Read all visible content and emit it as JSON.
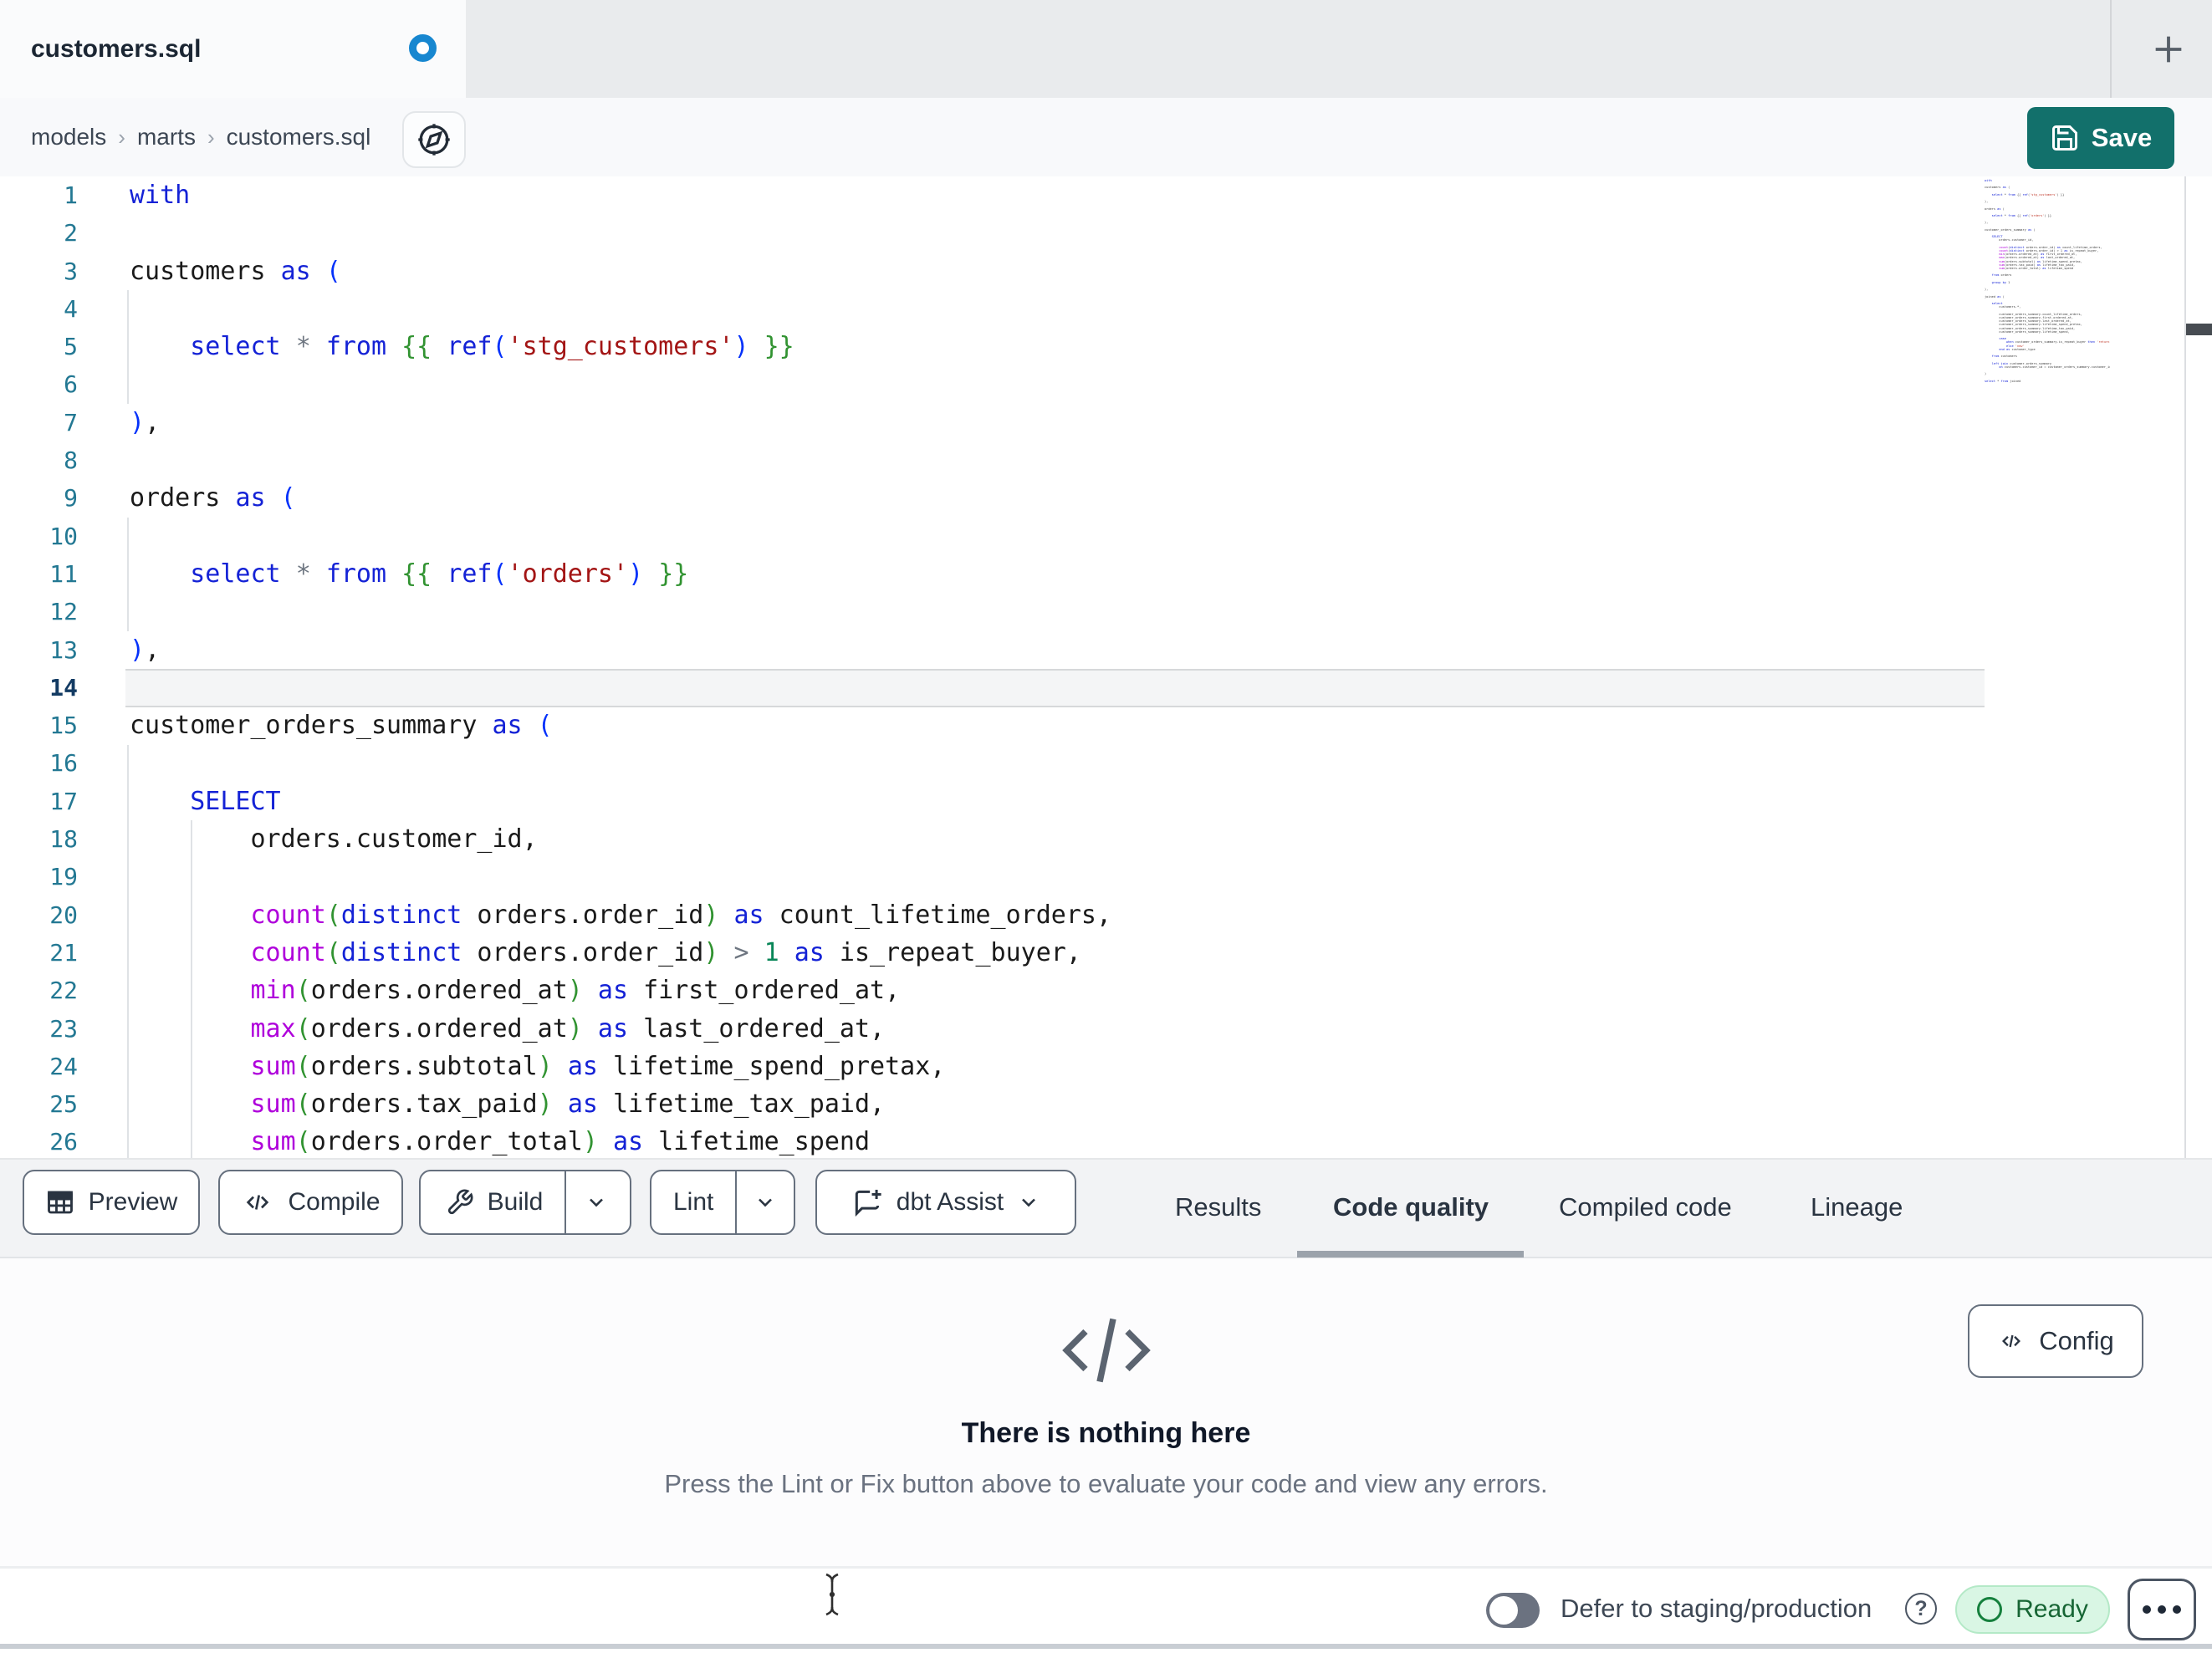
{
  "window": {
    "tab_title": "customers.sql",
    "modified": true,
    "new_tab_label": "+"
  },
  "breadcrumb": {
    "items": [
      "models",
      "marts",
      "customers.sql"
    ]
  },
  "save_label": "Save",
  "editor": {
    "active_line": 14,
    "lines": [
      {
        "n": 1,
        "tokens": [
          [
            "with",
            "k"
          ]
        ]
      },
      {
        "n": 2,
        "tokens": []
      },
      {
        "n": 3,
        "tokens": [
          [
            "customers ",
            "t"
          ],
          [
            "as",
            "k"
          ],
          [
            " ",
            "t"
          ],
          [
            "(",
            "b1"
          ]
        ]
      },
      {
        "n": 4,
        "tokens": []
      },
      {
        "n": 5,
        "tokens": [
          [
            "    ",
            "t"
          ],
          [
            "select",
            "k"
          ],
          [
            " ",
            "t"
          ],
          [
            "*",
            "o"
          ],
          [
            " ",
            "t"
          ],
          [
            "from",
            "k"
          ],
          [
            " ",
            "t"
          ],
          [
            "{{",
            "b2"
          ],
          [
            " ",
            "t"
          ],
          [
            "ref",
            "k"
          ],
          [
            "(",
            "b1"
          ],
          [
            "'stg_customers'",
            "s"
          ],
          [
            ")",
            "b1"
          ],
          [
            " ",
            "t"
          ],
          [
            "}}",
            "b2"
          ]
        ]
      },
      {
        "n": 6,
        "tokens": []
      },
      {
        "n": 7,
        "tokens": [
          [
            ")",
            "b1"
          ],
          [
            ",",
            "t"
          ]
        ]
      },
      {
        "n": 8,
        "tokens": []
      },
      {
        "n": 9,
        "tokens": [
          [
            "orders ",
            "t"
          ],
          [
            "as",
            "k"
          ],
          [
            " ",
            "t"
          ],
          [
            "(",
            "b1"
          ]
        ]
      },
      {
        "n": 10,
        "tokens": []
      },
      {
        "n": 11,
        "tokens": [
          [
            "    ",
            "t"
          ],
          [
            "select",
            "k"
          ],
          [
            " ",
            "t"
          ],
          [
            "*",
            "o"
          ],
          [
            " ",
            "t"
          ],
          [
            "from",
            "k"
          ],
          [
            " ",
            "t"
          ],
          [
            "{{",
            "b2"
          ],
          [
            " ",
            "t"
          ],
          [
            "ref",
            "k"
          ],
          [
            "(",
            "b1"
          ],
          [
            "'orders'",
            "s"
          ],
          [
            ")",
            "b1"
          ],
          [
            " ",
            "t"
          ],
          [
            "}}",
            "b2"
          ]
        ]
      },
      {
        "n": 12,
        "tokens": []
      },
      {
        "n": 13,
        "tokens": [
          [
            ")",
            "b1"
          ],
          [
            ",",
            "t"
          ]
        ]
      },
      {
        "n": 14,
        "tokens": []
      },
      {
        "n": 15,
        "tokens": [
          [
            "customer_orders_summary ",
            "t"
          ],
          [
            "as",
            "k"
          ],
          [
            " ",
            "t"
          ],
          [
            "(",
            "b1"
          ]
        ]
      },
      {
        "n": 16,
        "tokens": []
      },
      {
        "n": 17,
        "tokens": [
          [
            "    ",
            "t"
          ],
          [
            "SELECT",
            "k"
          ]
        ]
      },
      {
        "n": 18,
        "tokens": [
          [
            "        orders.customer_id,",
            "t"
          ]
        ]
      },
      {
        "n": 19,
        "tokens": []
      },
      {
        "n": 20,
        "tokens": [
          [
            "        ",
            "t"
          ],
          [
            "count",
            "f"
          ],
          [
            "(",
            "b2"
          ],
          [
            "distinct",
            "k"
          ],
          [
            " orders.order_id",
            "t"
          ],
          [
            ")",
            "b2"
          ],
          [
            " ",
            "t"
          ],
          [
            "as",
            "k"
          ],
          [
            " count_lifetime_orders,",
            "t"
          ]
        ]
      },
      {
        "n": 21,
        "tokens": [
          [
            "        ",
            "t"
          ],
          [
            "count",
            "f"
          ],
          [
            "(",
            "b2"
          ],
          [
            "distinct",
            "k"
          ],
          [
            " orders.order_id",
            "t"
          ],
          [
            ")",
            "b2"
          ],
          [
            " ",
            "t"
          ],
          [
            ">",
            "o"
          ],
          [
            " ",
            "t"
          ],
          [
            "1",
            "n"
          ],
          [
            " ",
            "t"
          ],
          [
            "as",
            "k"
          ],
          [
            " is_repeat_buyer,",
            "t"
          ]
        ]
      },
      {
        "n": 22,
        "tokens": [
          [
            "        ",
            "t"
          ],
          [
            "min",
            "f"
          ],
          [
            "(",
            "b2"
          ],
          [
            "orders.ordered_at",
            "t"
          ],
          [
            ")",
            "b2"
          ],
          [
            " ",
            "t"
          ],
          [
            "as",
            "k"
          ],
          [
            " first_ordered_at,",
            "t"
          ]
        ]
      },
      {
        "n": 23,
        "tokens": [
          [
            "        ",
            "t"
          ],
          [
            "max",
            "f"
          ],
          [
            "(",
            "b2"
          ],
          [
            "orders.ordered_at",
            "t"
          ],
          [
            ")",
            "b2"
          ],
          [
            " ",
            "t"
          ],
          [
            "as",
            "k"
          ],
          [
            " last_ordered_at,",
            "t"
          ]
        ]
      },
      {
        "n": 24,
        "tokens": [
          [
            "        ",
            "t"
          ],
          [
            "sum",
            "f"
          ],
          [
            "(",
            "b2"
          ],
          [
            "orders.subtotal",
            "t"
          ],
          [
            ")",
            "b2"
          ],
          [
            " ",
            "t"
          ],
          [
            "as",
            "k"
          ],
          [
            " lifetime_spend_pretax,",
            "t"
          ]
        ]
      },
      {
        "n": 25,
        "tokens": [
          [
            "        ",
            "t"
          ],
          [
            "sum",
            "f"
          ],
          [
            "(",
            "b2"
          ],
          [
            "orders.tax_paid",
            "t"
          ],
          [
            ")",
            "b2"
          ],
          [
            " ",
            "t"
          ],
          [
            "as",
            "k"
          ],
          [
            " lifetime_tax_paid,",
            "t"
          ]
        ]
      },
      {
        "n": 26,
        "tokens": [
          [
            "        ",
            "t"
          ],
          [
            "sum",
            "f"
          ],
          [
            "(",
            "b2"
          ],
          [
            "orders.order_total",
            "t"
          ],
          [
            ")",
            "b2"
          ],
          [
            " ",
            "t"
          ],
          [
            "as",
            "k"
          ],
          [
            " lifetime_spend",
            "t"
          ]
        ]
      }
    ],
    "minimap_lines": [
      "with",
      "",
      "customers as (",
      "",
      "    select * from {{ ref('stg_customers') }}",
      "",
      "),",
      "",
      "orders as (",
      "",
      "    select * from {{ ref('orders') }}",
      "",
      "),",
      "",
      "customer_orders_summary as (",
      "",
      "    SELECT",
      "        orders.customer_id,",
      "",
      "        count(distinct orders.order_id) as count_lifetime_orders,",
      "        count(distinct orders.order_id) > 1 as is_repeat_buyer,",
      "        min(orders.ordered_at) as first_ordered_at,",
      "        max(orders.ordered_at) as last_ordered_at,",
      "        sum(orders.subtotal) as lifetime_spend_pretax,",
      "        sum(orders.tax_paid) as lifetime_tax_paid,",
      "        sum(orders.order_total) as lifetime_spend",
      "",
      "    from orders",
      "",
      "    group by 1",
      "",
      "),",
      "",
      "joined as (",
      "",
      "    select",
      "        customers.*,",
      "",
      "        customer_orders_summary.count_lifetime_orders,",
      "        customer_orders_summary.first_ordered_at,",
      "        customer_orders_summary.last_ordered_at,",
      "        customer_orders_summary.lifetime_spend_pretax,",
      "        customer_orders_summary.lifetime_tax_paid,",
      "        customer_orders_summary.lifetime_spend,",
      "",
      "        case",
      "            when customer_orders_summary.is_repeat_buyer then 'returning'",
      "            else 'new'",
      "        end as customer_type",
      "",
      "    from customers",
      "",
      "    left join customer_orders_summary",
      "        on customers.customer_id = customer_orders_summary.customer_id",
      "",
      ")",
      "",
      "select * from joined"
    ]
  },
  "toolbar": {
    "buttons": [
      {
        "label": "Preview",
        "icon": "table-icon"
      },
      {
        "label": "Compile",
        "icon": "code-icon"
      },
      {
        "label": "Build",
        "icon": "wrench-icon",
        "split": true
      },
      {
        "label": "Lint",
        "split": true
      },
      {
        "label": "dbt Assist",
        "icon": "assist-icon",
        "chevron": true
      }
    ]
  },
  "tabs": [
    {
      "label": "Results"
    },
    {
      "label": "Code quality",
      "active": true
    },
    {
      "label": "Compiled code"
    },
    {
      "label": "Lineage"
    }
  ],
  "panel": {
    "title": "There is nothing here",
    "subtitle": "Press the Lint or Fix button above to evaluate your code and view any errors.",
    "config_label": "Config"
  },
  "statusbar": {
    "defer_label": "Defer to staging/production",
    "ready_label": "Ready"
  },
  "colors": {
    "accent_teal": "#12706b",
    "modified_dot_blue": "#1787d0",
    "ready_bg": "#d9f6e4",
    "ready_text": "#166534",
    "syntax": {
      "keyword": "#1422d6",
      "bracket_level1": "#0431fa",
      "bracket_level2": "#319331",
      "string": "#a31515",
      "function": "#af00db",
      "number": "#098658",
      "operator": "#6e7681",
      "text": "#1a1a1a",
      "line_number": "#237893",
      "active_line_number": "#133b63"
    }
  }
}
